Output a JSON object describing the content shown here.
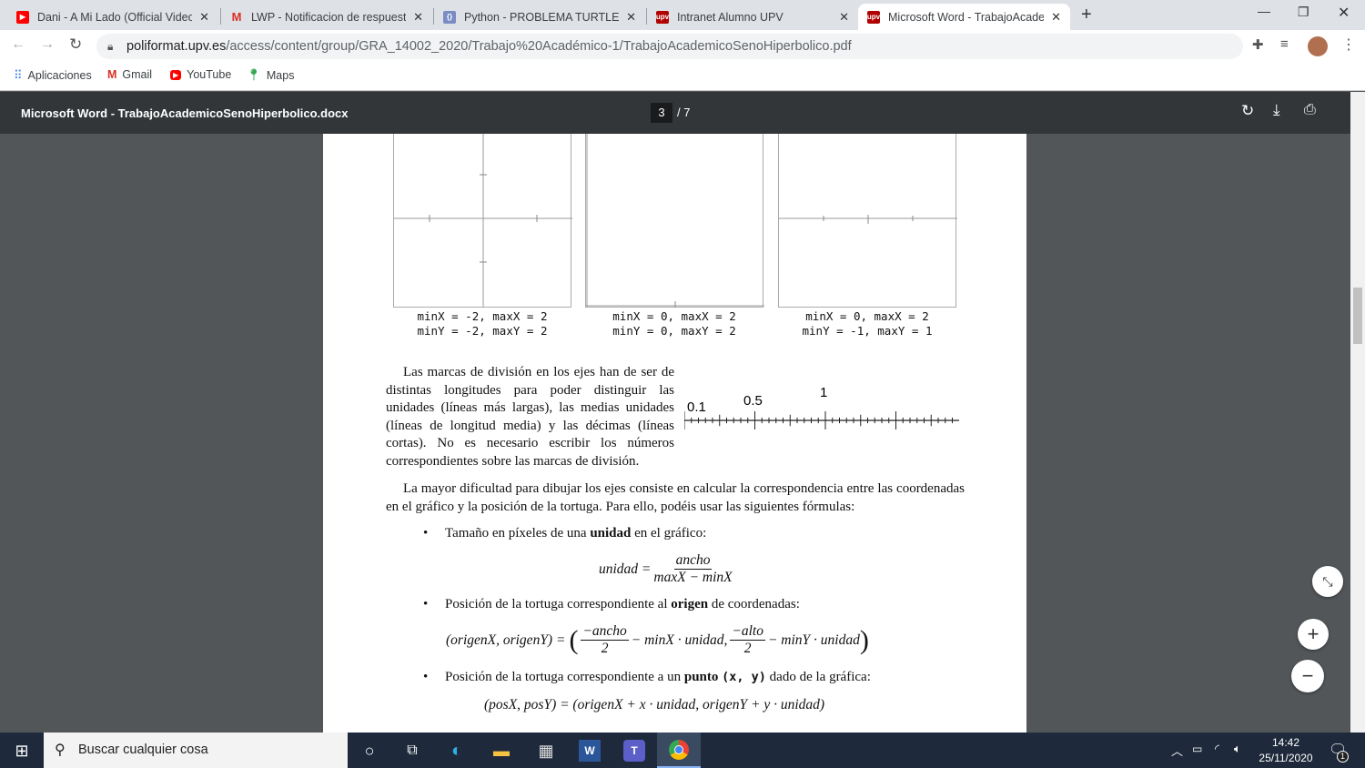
{
  "browser": {
    "tabs": [
      {
        "label": "Dani - A Mi Lado (Official Video)",
        "icon": "youtube-icon",
        "color": "#ff0000"
      },
      {
        "label": "LWP - Notificacion de respuesta a",
        "icon": "gmail-icon",
        "color": "#d93025"
      },
      {
        "label": "Python - PROBLEMA TURTLE EJES",
        "icon": "doc-icon",
        "color": "#7b8cc4"
      },
      {
        "label": "Intranet Alumno UPV",
        "icon": "upv-icon",
        "color": "#b00000"
      },
      {
        "label": "Microsoft Word - TrabajoAcademicoSenoHiperbolico.docx",
        "icon": "upv-icon",
        "color": "#b00000"
      }
    ],
    "new_tab": "+",
    "url_domain": "poliformat.upv.es",
    "url_path": "/access/content/group/GRA_14002_2020/Trabajo%20Académico-1/TrabajoAcademicoSenoHiperbolico.pdf",
    "bookmarks": [
      "Aplicaciones",
      "Gmail",
      "YouTube",
      "Maps"
    ]
  },
  "pdf": {
    "title": "Microsoft Word - TrabajoAcademicoSenoHiperbolico.docx",
    "current_page": "3",
    "total_pages": "/  7"
  },
  "doc": {
    "graphs": [
      {
        "l1": "minX = -2, maxX = 2",
        "l2": "minY = -2, maxY = 2"
      },
      {
        "l1": "minX = 0, maxX = 2",
        "l2": "minY = 0, maxY = 2"
      },
      {
        "l1": "minX = 0, maxX = 2",
        "l2": "minY = -1, maxY = 1"
      }
    ],
    "p1": "Las marcas de división en los ejes han de ser de distintas longitudes para poder distinguir las unidades (líneas más largas), las medias unidades (líneas de longitud media) y las décimas (líneas cortas). No es necesario escribir los números correspondientes sobre las marcas de división.",
    "numberline": {
      "l01": "0.1",
      "l05": "0.5",
      "l1": "1"
    },
    "p2": "La mayor dificultad para dibujar los ejes consiste en calcular la correspondencia entre las coordenadas en el gráfico y la posición de la tortuga. Para ello, podéis usar las siguientes fórmulas:",
    "b1": {
      "pre": "Tamaño en píxeles de una ",
      "bold": "unidad",
      "post": " en el gráfico:"
    },
    "f1": {
      "lhs": "unidad =",
      "num": "ancho",
      "den": "maxX − minX"
    },
    "b2": {
      "pre": "Posición de la tortuga correspondiente al ",
      "bold": "origen",
      "post": " de coordenadas:"
    },
    "f2": {
      "lhs": "(origenX, origenY) =",
      "n1": "−ancho",
      "d1": "2",
      "m1": "− minX · unidad,",
      "n2": "−alto",
      "d2": "2",
      "m2": "− minY · unidad"
    },
    "b3": {
      "pre": "Posición de la tortuga correspondiente a un ",
      "bold": "punto",
      "code": "(x, y)",
      "post": " dado de la gráfica:"
    },
    "f3": "(posX, posY) = (origenX + x · unidad, origenY + y · unidad)"
  },
  "taskbar": {
    "search_placeholder": "Buscar cualquier cosa",
    "time": "14:42",
    "date": "25/11/2020",
    "notifications": "1"
  }
}
